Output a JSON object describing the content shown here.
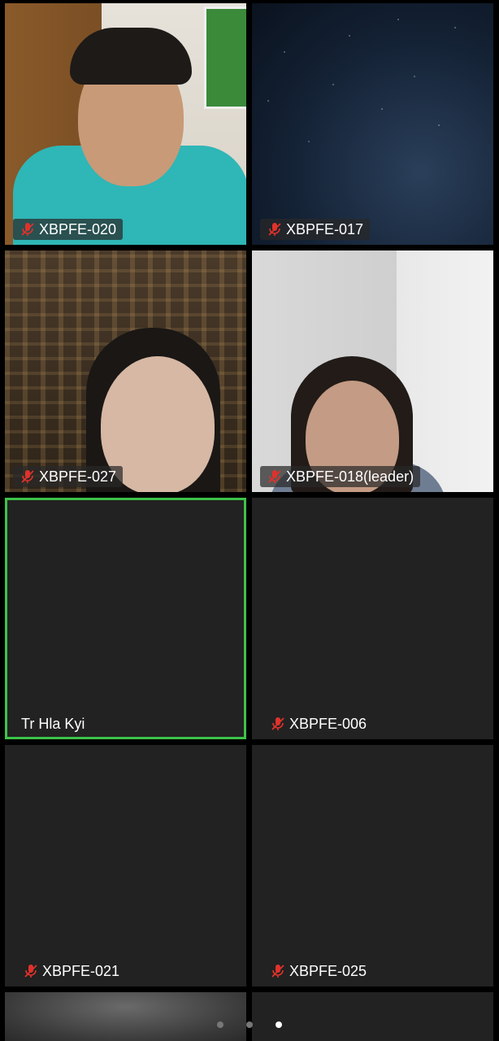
{
  "participants": [
    {
      "name": "XBPFE-020",
      "muted": true,
      "video": "room"
    },
    {
      "name": "XBPFE-017",
      "muted": true,
      "video": "sky"
    },
    {
      "name": "XBPFE-027",
      "muted": true,
      "video": "city"
    },
    {
      "name": "XBPFE-018(leader)",
      "muted": true,
      "video": "wall"
    },
    {
      "name": "Tr Hla Kyi",
      "muted": false,
      "video": "off",
      "active_speaker": true
    },
    {
      "name": "XBPFE-006",
      "muted": true,
      "video": "off"
    },
    {
      "name": "XBPFE-021",
      "muted": true,
      "video": "off"
    },
    {
      "name": "XBPFE-025",
      "muted": true,
      "video": "off"
    }
  ],
  "pagination": {
    "page_count": 3,
    "current_page": 3
  },
  "colors": {
    "active_speaker_border": "#3ec34a",
    "muted_icon": "#e0322b",
    "tile_background": "#222222"
  },
  "icons": {
    "muted": "mic-muted-icon"
  }
}
